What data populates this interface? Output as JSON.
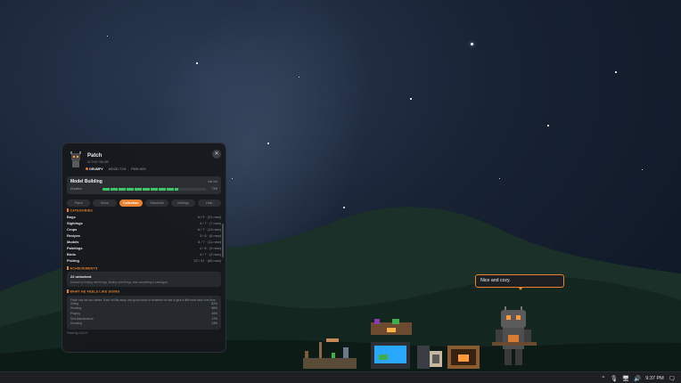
{
  "colors": {
    "accent": "#e8822e",
    "progress": "#3fc468",
    "panel_bg": "#16181c"
  },
  "pet": {
    "name": "Patch",
    "status_line": "ACTIVE ONLINE",
    "mood": "GRUMPY",
    "meta": "MOOD 71%",
    "meta2": "PWR 46%",
    "close_icon": "close-icon"
  },
  "activity": {
    "title": "Model Building",
    "state": "Idle left",
    "duration_label": "Duration",
    "progress": 0.73,
    "percent": "73%"
  },
  "tabs": [
    "Patch",
    "Mood",
    "Collection",
    "Wardrobe",
    "Settings",
    "Help"
  ],
  "active_tab": "Collection",
  "categories": {
    "heading": "CATEGORIES",
    "items": [
      {
        "name": "Bugs",
        "value": "6 / 9 · (21 new)"
      },
      {
        "name": "Sightings",
        "value": "4 / 7 · (7 new)"
      },
      {
        "name": "Crops",
        "value": "6 / 7 · (13 new)"
      },
      {
        "name": "Recipes",
        "value": "3 / 8 · (6 new)"
      },
      {
        "name": "Models",
        "value": "6 / 7 · (11 new)"
      },
      {
        "name": "Paintings",
        "value": "4 / 8 · (9 new)"
      },
      {
        "name": "Birds",
        "value": "4 / 7 · (3 new)"
      },
      {
        "name": "Fishing",
        "value": "22 / 31 · (66 new)"
      }
    ]
  },
  "achievements": {
    "heading": "ACHIEVEMENTS",
    "count": "22 unlocked.",
    "note": "Earned by finding new things, finding rare things, and completing a catalogue."
  },
  "feels": {
    "heading": "WHAT HE FEELS LIKE DOING",
    "desc": "Patch has his own tastes. Each hit lifts away, and good mood or whatever he has to give a little treat back over time.",
    "items": [
      {
        "name": "Sitting",
        "value": "82%"
      },
      {
        "name": "Reading",
        "value": "66%"
      },
      {
        "name": "Playing",
        "value": "49%"
      },
      {
        "name": "Self-Maintenance",
        "value": "17%"
      },
      {
        "name": "Smoking",
        "value": "13%"
      }
    ]
  },
  "footer": "Patching v0.6.97",
  "bubble": {
    "text": "Nice and cozy."
  },
  "taskbar": {
    "time": "9:37 PM",
    "icons": [
      "chevron-up-icon",
      "mic-icon",
      "network-icon",
      "speaker-icon",
      "notification-icon"
    ]
  }
}
